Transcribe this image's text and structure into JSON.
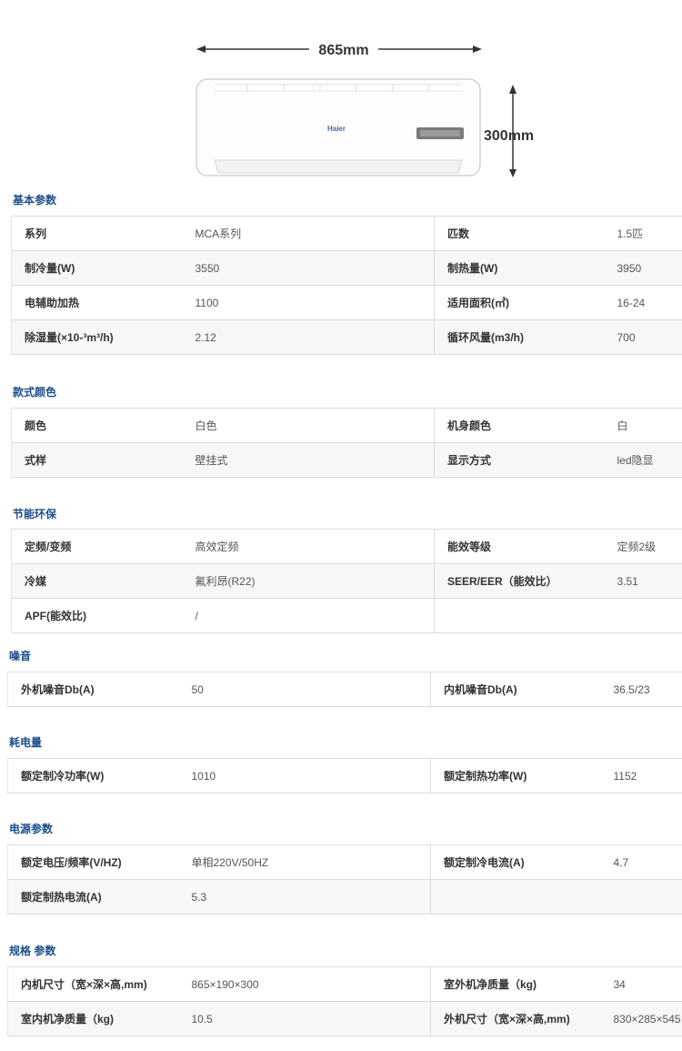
{
  "product_image": {
    "width_label": "865mm",
    "height_label": "300mm",
    "brand_mark": "Haier"
  },
  "sections": [
    {
      "title": "基本参数",
      "rows": [
        {
          "k1": "系列",
          "v1": "MCA系列",
          "k2": "匹数",
          "v2": "1.5匹"
        },
        {
          "k1": "制冷量(W)",
          "v1": "3550",
          "k2": "制热量(W)",
          "v2": "3950"
        },
        {
          "k1": "电辅助加热",
          "v1": "1100",
          "k2": "适用面积(㎡)",
          "v2": "16-24"
        },
        {
          "k1": "除湿量(×10-³m³/h)",
          "v1": "2.12",
          "k2": "循环风量(m3/h)",
          "v2": "700"
        }
      ]
    },
    {
      "title": "款式颜色",
      "rows": [
        {
          "k1": "颜色",
          "v1": "白色",
          "k2": "机身颜色",
          "v2": "白"
        },
        {
          "k1": "式样",
          "v1": "壁挂式",
          "k2": "显示方式",
          "v2": "led隐显"
        }
      ]
    },
    {
      "title": "节能环保",
      "rows": [
        {
          "k1": "定频/变频",
          "v1": "高效定频",
          "k2": "能效等级",
          "v2": "定频2级"
        },
        {
          "k1": "冷媒",
          "v1": "氟利昂(R22)",
          "k2": "SEER/EER（能效比）",
          "v2": "3.51"
        },
        {
          "k1": "APF(能效比)",
          "v1": "/",
          "k2": "",
          "v2": ""
        }
      ]
    },
    {
      "title": "噪音",
      "rows": [
        {
          "k1": "外机噪音Db(A)",
          "v1": "50",
          "k2": "内机噪音Db(A)",
          "v2": "36.5/23"
        }
      ]
    },
    {
      "title": "耗电量",
      "rows": [
        {
          "k1": "额定制冷功率(W)",
          "v1": "1010",
          "k2": "额定制热功率(W)",
          "v2": "1152"
        }
      ]
    },
    {
      "title": "电源参数",
      "rows": [
        {
          "k1": "额定电压/频率(V/HZ)",
          "v1": "单相220V/50HZ",
          "k2": "额定制冷电流(A)",
          "v2": "4.7"
        },
        {
          "k1": "额定制热电流(A)",
          "v1": "5.3",
          "k2": "",
          "v2": ""
        }
      ]
    },
    {
      "title": "规格 参数",
      "rows": [
        {
          "k1": "内机尺寸（宽×深×高,mm)",
          "v1": "865×190×300",
          "k2": "室外机净质量（kg)",
          "v2": "34"
        },
        {
          "k1": "室内机净质量（kg)",
          "v1": "10.5",
          "k2": "外机尺寸（宽×深×高,mm)",
          "v2": "830×285×545"
        }
      ]
    }
  ]
}
